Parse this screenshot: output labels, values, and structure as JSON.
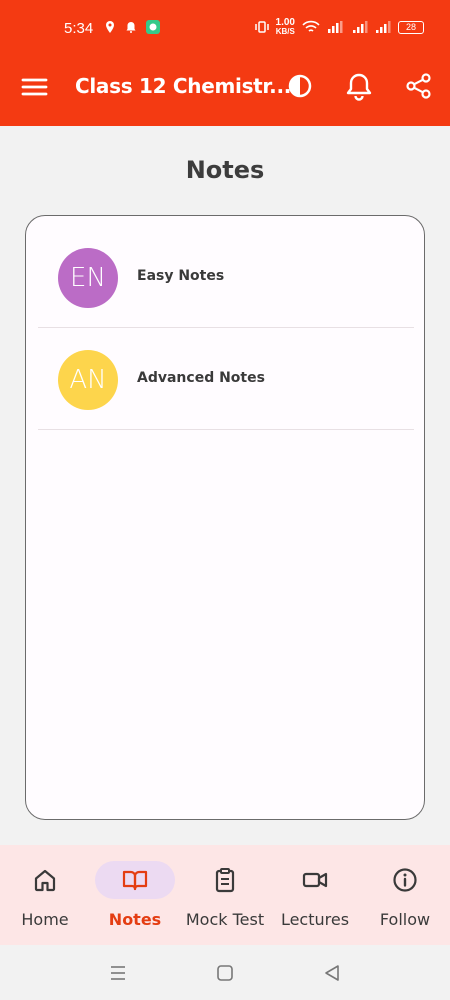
{
  "status_bar": {
    "time": "5:34",
    "net_speed_value": "1.00",
    "net_speed_unit": "KB/S",
    "battery": "28"
  },
  "app_bar": {
    "title": "Class 12 Chemistr...",
    "background_color": "#f43a12"
  },
  "page": {
    "title": "Notes"
  },
  "notes": [
    {
      "initials": "EN",
      "label": "Easy Notes",
      "avatar_color": "#bb6cc6"
    },
    {
      "initials": "AN",
      "label": "Advanced Notes",
      "avatar_color": "#fdd54c"
    }
  ],
  "bottom_nav": {
    "items": [
      {
        "label": "Home",
        "icon": "home-icon",
        "active": false
      },
      {
        "label": "Notes",
        "icon": "book-open-icon",
        "active": true
      },
      {
        "label": "Mock Test",
        "icon": "clipboard-icon",
        "active": false
      },
      {
        "label": "Lectures",
        "icon": "video-icon",
        "active": false
      },
      {
        "label": "Follow",
        "icon": "info-icon",
        "active": false
      }
    ],
    "active_color": "#e43d12"
  },
  "system_nav": {
    "icons": [
      "recents-icon",
      "home-square-icon",
      "back-triangle-icon"
    ]
  }
}
